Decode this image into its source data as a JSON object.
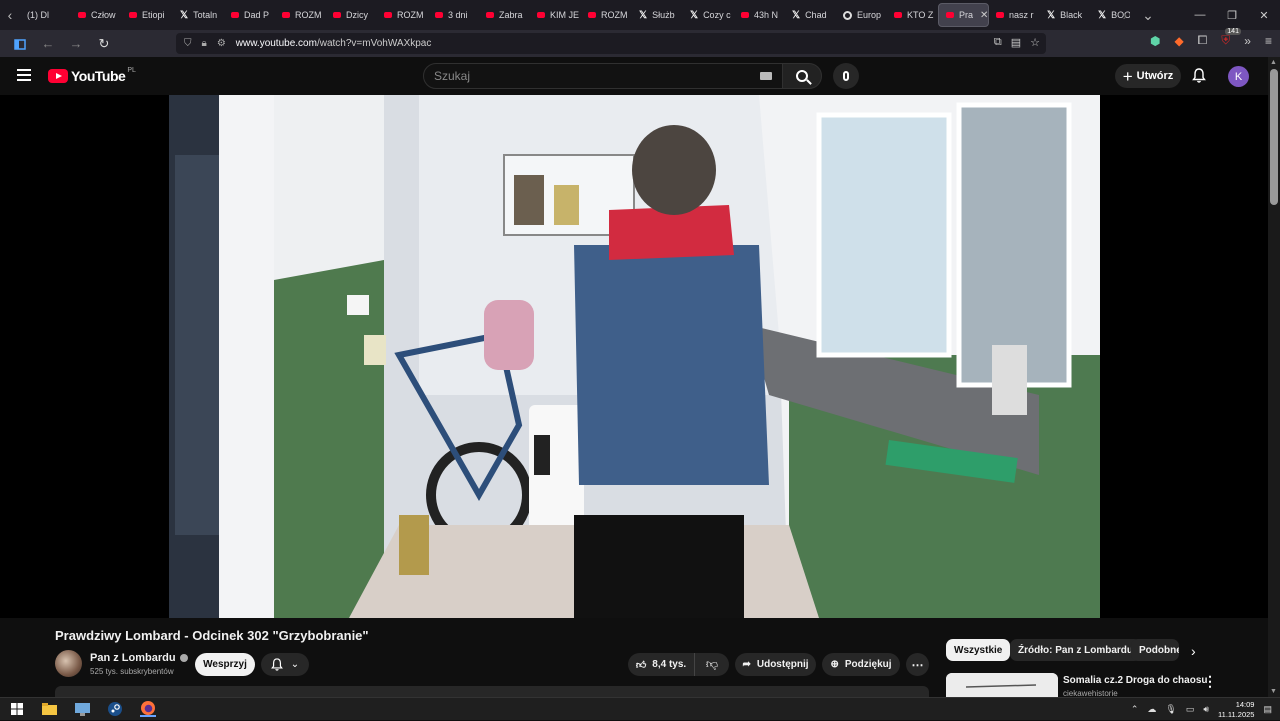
{
  "browser": {
    "tabs": [
      {
        "label": "(1) Dl",
        "favicon": "none"
      },
      {
        "label": "Człow",
        "favicon": "youtube-icon"
      },
      {
        "label": "Etiopi",
        "favicon": "youtube-icon"
      },
      {
        "label": "Totaln",
        "favicon": "x-icon"
      },
      {
        "label": "Dad P",
        "favicon": "youtube-icon"
      },
      {
        "label": "ROZM",
        "favicon": "youtube-icon"
      },
      {
        "label": "Dzicy",
        "favicon": "youtube-icon"
      },
      {
        "label": "ROZM",
        "favicon": "youtube-icon"
      },
      {
        "label": "3 dni",
        "favicon": "youtube-icon"
      },
      {
        "label": "Zabra",
        "favicon": "youtube-icon"
      },
      {
        "label": "KIM JE",
        "favicon": "youtube-icon"
      },
      {
        "label": "ROZM",
        "favicon": "youtube-icon"
      },
      {
        "label": "Służb",
        "favicon": "x-icon"
      },
      {
        "label": "Cozy c",
        "favicon": "x-icon"
      },
      {
        "label": "43h N",
        "favicon": "youtube-icon"
      },
      {
        "label": "Chad",
        "favicon": "x-icon"
      },
      {
        "label": "Europ",
        "favicon": "globe-icon"
      },
      {
        "label": "KTO Z",
        "favicon": "youtube-icon"
      },
      {
        "label": "Pra",
        "favicon": "youtube-icon",
        "active": true
      },
      {
        "label": "nasz r",
        "favicon": "youtube-icon"
      },
      {
        "label": "Black",
        "favicon": "x-icon"
      },
      {
        "label": "BOOF",
        "favicon": "x-icon"
      }
    ],
    "url": {
      "domain": "www.youtube.com",
      "path": "/watch?v=mVohWAXkpac"
    },
    "extensions_badge": "141"
  },
  "youtube": {
    "country_code": "PL",
    "logo_text": "YouTube",
    "search_placeholder": "Szukaj",
    "create_label": "Utwórz",
    "avatar_letter": "K",
    "video": {
      "title": "Prawdziwy Lombard - Odcinek 302 \"Grzybobranie\"",
      "channel_name": "Pan z Lombardu",
      "subscribers": "525 tys. subskrybentów",
      "support_label": "Wesprzyj",
      "likes": "8,4 tys.",
      "share_label": "Udostępnij",
      "thanks_label": "Podziękuj"
    },
    "chips": [
      "Wszystkie",
      "Źródło: Pan z Lombardu",
      "Podobne"
    ],
    "related": [
      {
        "title": "Somalia cz.2 Droga do chaosu",
        "channel": "ciekawehistorie"
      }
    ]
  },
  "taskbar": {
    "time": "14:09",
    "date": "11.11.2025"
  },
  "colors": {
    "accent_red": "#ff0033",
    "avatar_purple": "#7e57c2",
    "background": "#0f0f0f"
  }
}
